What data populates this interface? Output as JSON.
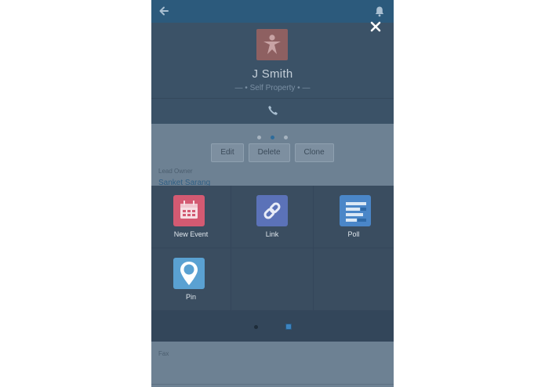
{
  "profile": {
    "name": "J Smith",
    "subtitle": "— • Self Property • —"
  },
  "actions": {
    "edit": "Edit",
    "delete": "Delete",
    "clone": "Clone"
  },
  "fields": {
    "lead_owner_label": "Lead Owner",
    "lead_owner_value": "Sanket Sarang",
    "fax_label": "Fax"
  },
  "share_sheet": {
    "items": [
      {
        "label": "New Event",
        "icon": "calendar-icon",
        "color": "#d35a72"
      },
      {
        "label": "Link",
        "icon": "link-icon",
        "color": "#5b72b8"
      },
      {
        "label": "Poll",
        "icon": "poll-icon",
        "color": "#4a86c8"
      },
      {
        "label": "Pin",
        "icon": "map-pin-icon",
        "color": "#5aa1d2"
      }
    ]
  },
  "colors": {
    "navbar": "#2c5a7c",
    "accent": "#2e6c9b"
  }
}
